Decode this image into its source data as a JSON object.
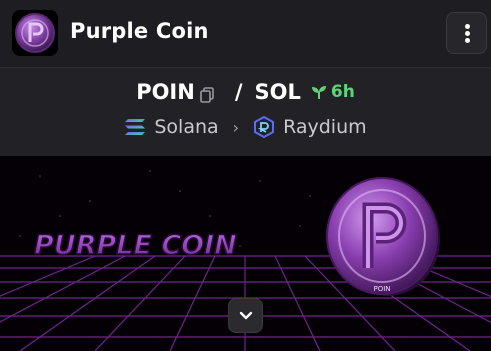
{
  "header": {
    "title": "Purple Coin",
    "logo_icon": "purple-coin-logo",
    "menu_icon": "more-vertical-icon"
  },
  "pair": {
    "base": "POIN",
    "separator": "/",
    "quote": "SOL",
    "age": "6h",
    "age_icon": "sprout-icon",
    "chain": "Solana",
    "dex": "Raydium"
  },
  "banner": {
    "text": "PURPLE COIN",
    "coin_text": "POIN"
  },
  "colors": {
    "accent_green": "#5fd27a",
    "purple": "#9b4dcc",
    "background": "#1c1c20"
  }
}
